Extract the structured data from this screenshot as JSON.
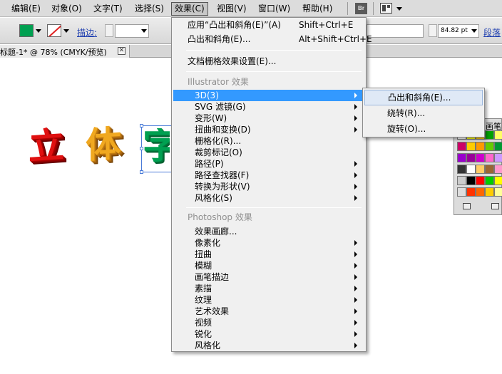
{
  "menubar": {
    "items": [
      {
        "label": "编辑(E)"
      },
      {
        "label": "对象(O)"
      },
      {
        "label": "文字(T)"
      },
      {
        "label": "选择(S)"
      },
      {
        "label": "效果(C)"
      },
      {
        "label": "视图(V)"
      },
      {
        "label": "窗口(W)"
      },
      {
        "label": "帮助(H)"
      }
    ],
    "bridge_label": "Br"
  },
  "controlbar": {
    "fill_color": "#00a051",
    "stroke_label": "描边:",
    "size_value": "84.82 pt",
    "para_label": "段落"
  },
  "document": {
    "tab_title": "标题-1* @ 78% (CMYK/预览)"
  },
  "artwork": {
    "chars": [
      "立",
      "体",
      "字"
    ],
    "colors": [
      "#e01010",
      "#f0a820",
      "#00a051"
    ]
  },
  "swatches_panel": {
    "title": "画笔"
  },
  "effect_menu": {
    "items": [
      {
        "label": "应用“凸出和斜角(E)”(A)",
        "shortcut": "Shift+Ctrl+E"
      },
      {
        "label": "凸出和斜角(E)...",
        "shortcut": "Alt+Shift+Ctrl+E"
      },
      {
        "label": "文档栅格效果设置(E)..."
      },
      {
        "label": "Illustrator 效果",
        "header": true
      },
      {
        "label": "3D(3)",
        "submenu": true,
        "highlighted": true
      },
      {
        "label": "SVG 滤镜(G)",
        "submenu": true
      },
      {
        "label": "变形(W)",
        "submenu": true
      },
      {
        "label": "扭曲和变换(D)",
        "submenu": true
      },
      {
        "label": "栅格化(R)..."
      },
      {
        "label": "裁剪标记(O)"
      },
      {
        "label": "路径(P)",
        "submenu": true
      },
      {
        "label": "路径查找器(F)",
        "submenu": true
      },
      {
        "label": "转换为形状(V)",
        "submenu": true
      },
      {
        "label": "风格化(S)",
        "submenu": true
      },
      {
        "label": "Photoshop 效果",
        "header": true
      },
      {
        "label": "效果画廊..."
      },
      {
        "label": "像素化",
        "submenu": true
      },
      {
        "label": "扭曲",
        "submenu": true
      },
      {
        "label": "模糊",
        "submenu": true
      },
      {
        "label": "画笔描边",
        "submenu": true
      },
      {
        "label": "素描",
        "submenu": true
      },
      {
        "label": "纹理",
        "submenu": true
      },
      {
        "label": "艺术效果",
        "submenu": true
      },
      {
        "label": "视频",
        "submenu": true
      },
      {
        "label": "锐化",
        "submenu": true
      },
      {
        "label": "风格化",
        "submenu": true
      }
    ]
  },
  "submenu_3d": {
    "items": [
      {
        "label": "凸出和斜角(E)..."
      },
      {
        "label": "绕转(R)..."
      },
      {
        "label": "旋转(O)..."
      }
    ]
  }
}
